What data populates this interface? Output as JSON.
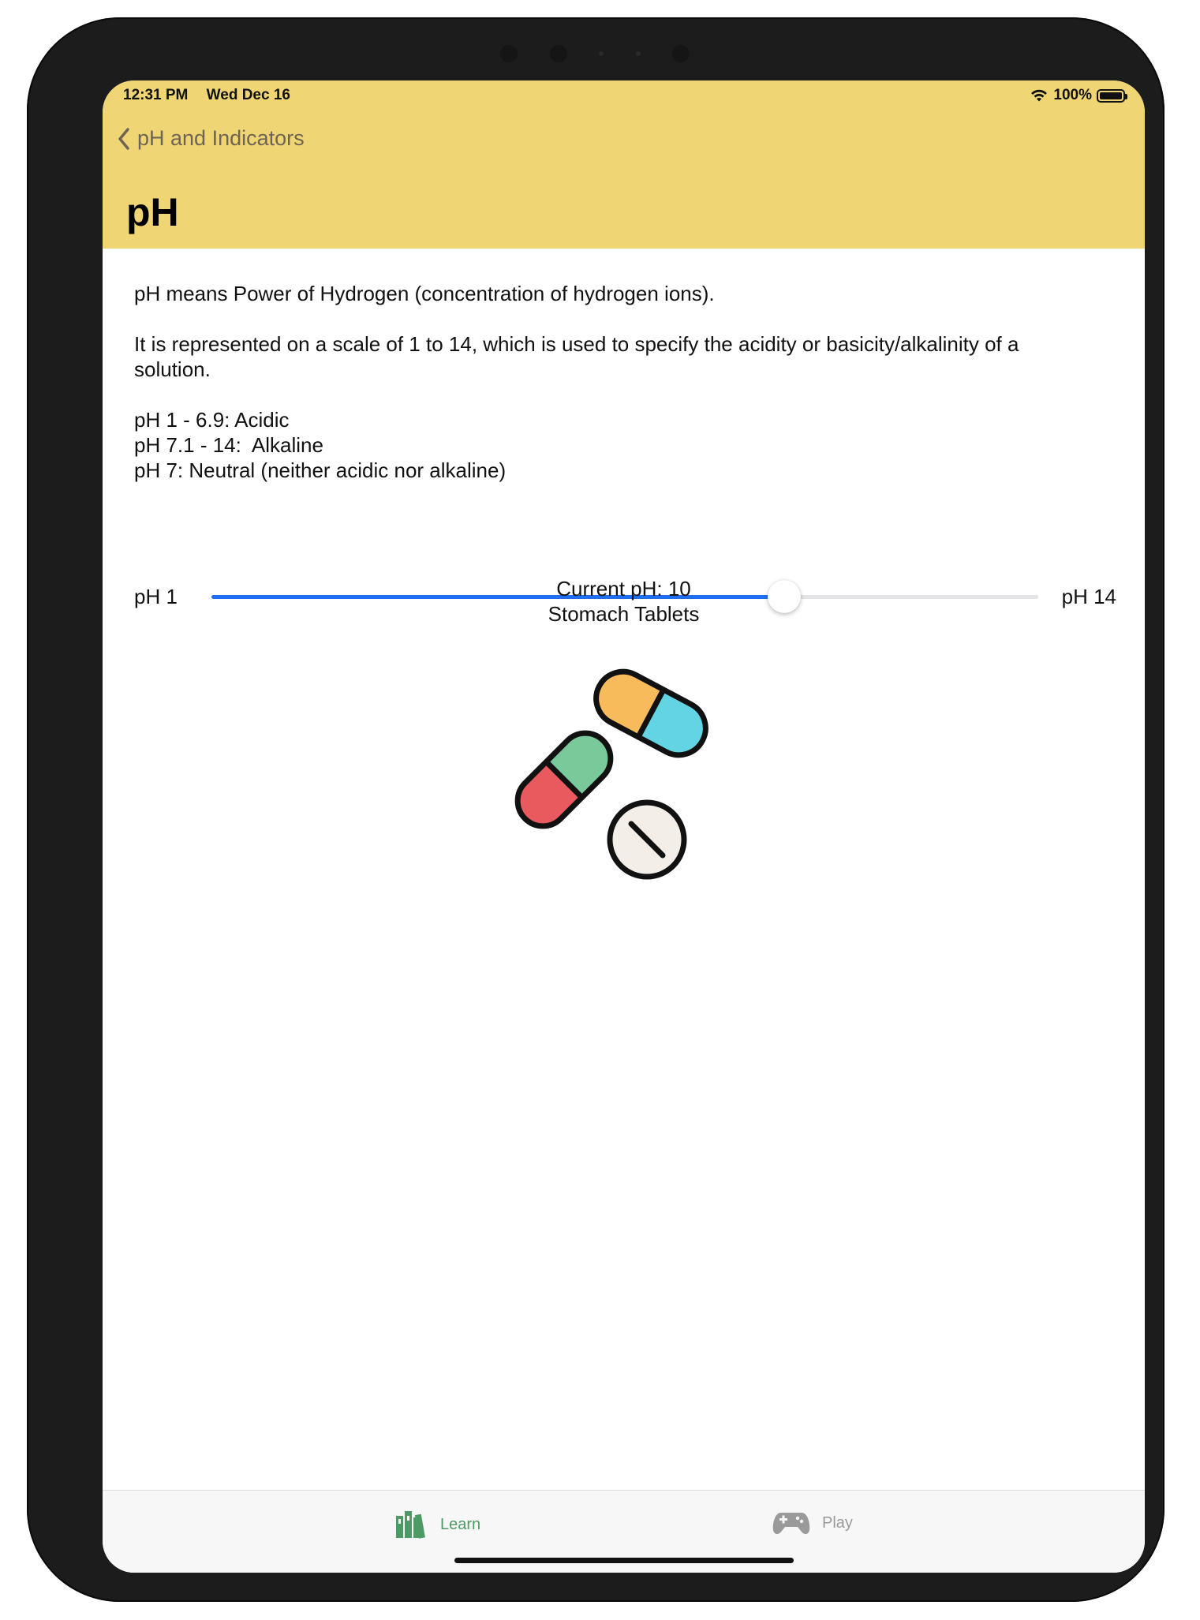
{
  "status_bar": {
    "time": "12:31 PM",
    "date": "Wed Dec 16",
    "battery": "100%"
  },
  "nav": {
    "back_label": "pH and Indicators",
    "title": "pH"
  },
  "content": {
    "definition": "pH means Power of Hydrogen (concentration of hydrogen ions).",
    "scale_text": "It is represented on a scale of 1 to 14, which is used to specify the acidity or basicity/alkalinity of a solution.",
    "ranges": [
      "pH 1 - 6.9: Acidic",
      "pH 7.1 - 14:  Alkaline",
      "pH 7: Neutral (neither acidic nor alkaline)"
    ]
  },
  "slider": {
    "min_label": "pH 1",
    "max_label": "pH 14",
    "min": 1,
    "max": 14,
    "value": 10,
    "fill_color": "#1f6ff5"
  },
  "result": {
    "current_label": "Current pH: 10",
    "example": "Stomach Tablets",
    "image_icon": "pills-icon"
  },
  "tabs": [
    {
      "label": "Learn",
      "icon": "books-icon",
      "selected": true
    },
    {
      "label": "Play",
      "icon": "gamepad-icon",
      "selected": false
    }
  ],
  "colors": {
    "header": "#efd573",
    "accent_learn": "#4e9a66",
    "slider": "#1f6ff5"
  }
}
